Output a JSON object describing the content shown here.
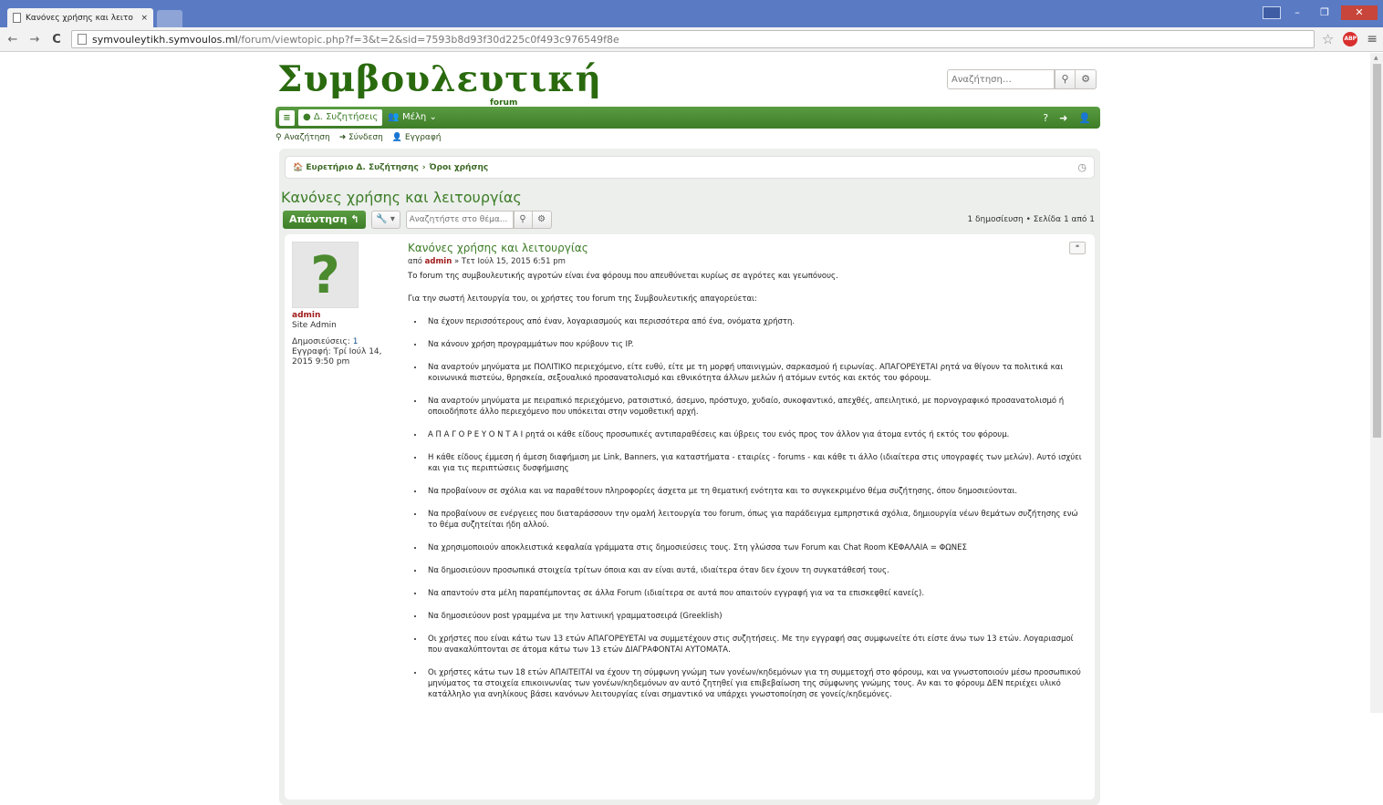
{
  "browser": {
    "tab_title": "Κανόνες χρήσης και λειτο",
    "tab_close": "×",
    "url_host": "symvouleytikh.symvoulos.ml",
    "url_path": "/forum/viewtopic.php?f=3&t=2&sid=7593b8d93f30d225c0f493c976549f8e",
    "back": "←",
    "forward": "→",
    "reload": "C",
    "star_icon": "☆",
    "abp_label": "ABP",
    "menu_icon": "≡",
    "win_min": "–",
    "win_max": "❐",
    "win_close": "✕"
  },
  "site": {
    "logo": "Συμβουλευτική",
    "logo_sub": "forum",
    "search_placeholder": "Αναζήτηση…",
    "search_icon": "⚲",
    "gear_icon": "⚙"
  },
  "navbar": {
    "menu_icon": "≡",
    "forum_label": "● Δ. Συζητήσεις",
    "members_label": "👥 Μέλη ⌄",
    "help_icon": "?",
    "login_icon": "➜",
    "register_icon": "👤"
  },
  "subnav": {
    "search": "⚲ Αναζήτηση",
    "login": "➜ Σύνδεση",
    "register": "👤 Εγγραφή"
  },
  "breadcrumbs": {
    "home": "🏠 Ευρετήριο Δ. Συζήτησης",
    "sep": "›",
    "current": "Όροι χρήσης",
    "clock_icon": "◷"
  },
  "topic": {
    "title": "Κανόνες χρήσης και λειτουργίας",
    "reply_label": "Απάντηση ↰",
    "tools_label": "🔧 ▾",
    "search_placeholder": "Αναζητήστε στο θέμα...",
    "pagination": "1 δημοσίευση • Σελίδα 1 από 1"
  },
  "post": {
    "avatar_char": "?",
    "author": "admin",
    "rank": "Site Admin",
    "posts_label": "Δημοσιεύσεις:",
    "posts_value": "1",
    "joined": "Εγγραφή: Τρί Ιούλ 14, 2015 9:50 pm",
    "quote_label": "❝",
    "title": "Κανόνες χρήσης και λειτουργίας",
    "meta_prefix": "από",
    "meta_author": "admin",
    "meta_date": "» Τετ Ιούλ 15, 2015 6:51 pm",
    "intro": "Το forum της συμβουλευτικής αγροτών είναι ένα φόρουμ που απευθύνεται κυρίως σε αγρότες και γεωπόνους.",
    "intro2": "Για την σωστή λειτουργία του, οι χρήστες του forum της Συμβουλευτικής απαγορεύεται:",
    "rules": [
      "Να έχουν περισσότερους από έναν, λογαριασμούς και περισσότερα από ένα, ονόματα χρήστη.",
      "Να κάνουν χρήση προγραμμάτων που κρύβουν τις IP.",
      "Να αναρτούν μηνύματα με ΠΟΛΙΤΙΚΟ περιεχόμενο, είτε ευθύ, είτε με τη μορφή υπαινιγμών, σαρκασμού ή ειρωνίας. ΑΠΑΓΟΡΕΥΕΤΑΙ ρητά να θίγουν τα πολιτικά και κοινωνικά πιστεύω, θρησκεία, σεξουαλικό προσανατολισμό και εθνικότητα άλλων μελών ή ατόμων εντός και εκτός του φόρουμ.",
      "Να αναρτούν μηνύματα με πειραπικό περιεχόμενο, ρατσιστικό, άσεμνο, πρόστυχο, χυδαίο, συκοφαντικό, απεχθές, απειλητικό, με πορνογραφικό προσανατολισμό ή οποιοδήποτε άλλο περιεχόμενο που υπόκειται στην νομοθετική αρχή.",
      "Α Π Α Γ Ο Ρ Ε Υ Ο Ν Τ Α Ι ρητά οι κάθε είδους προσωπικές αντιπαραθέσεις και ύβρεις του ενός προς τον άλλον για άτομα εντός ή εκτός του φόρουμ.",
      "Η κάθε είδους έμμεση ή άμεση διαφήμιση με Link, Banners, για καταστήματα - εταιρίες - forums - και κάθε τι άλλο (ιδιαίτερα στις υπογραφές των μελών). Αυτό ισχύει και για τις περιπτώσεις δυσφήμισης",
      "Να προβαίνουν σε σχόλια και να παραθέτουν πληροφορίες άσχετα με τη θεματική ενότητα και το συγκεκριμένο θέμα συζήτησης, όπου δημοσιεύονται.",
      "Να προβαίνουν σε ενέργειες που διαταράσσουν την ομαλή λειτουργία του forum, όπως για παράδειγμα εμπρηστικά σχόλια, δημιουργία νέων θεμάτων συζήτησης ενώ το θέμα συζητείται ήδη αλλού.",
      "Να χρησιμοποιούν αποκλειστικά κεφαλαία γράμματα στις δημοσιεύσεις τους. Στη γλώσσα των Forum και Chat Room ΚΕΦΑΛΑΙΑ = ΦΩΝΕΣ",
      "Να δημοσιεύουν προσωπικά στοιχεία τρίτων όποια και αν είναι αυτά, ιδιαίτερα όταν δεν έχουν τη συγκατάθεσή τους.",
      "Να απαντούν στα μέλη παραπέμποντας σε άλλα Forum (ιδιαίτερα σε αυτά που απαιτούν εγγραφή για να τα επισκεφθεί κανείς).",
      "Να δημοσιεύουν post γραμμένα με την λατινική γραμματοσειρά (Greeklish)",
      "Οι χρήστες που είναι κάτω των 13 ετών ΑΠΑΓΟΡΕΥΕΤΑΙ να συμμετέχουν στις συζητήσεις. Με την εγγραφή σας συμφωνείτε ότι είστε άνω των 13 ετών. Λογαριασμοί που ανακαλύπτονται σε άτομα κάτω των 13 ετών ΔΙΑΓΡΑΦΟΝΤΑΙ ΑΥΤΟΜΑΤΑ.",
      "Οι χρήστες κάτω των 18 ετών ΑΠΑΙΤΕΙΤΑΙ να έχουν τη σύμφωνη γνώμη των γονέων/κηδεμόνων για τη συμμετοχή στο φόρουμ, και να γνωστοποιούν μέσω προσωπικού μηνύματος τα στοιχεία επικοινωνίας των γονέων/κηδεμόνων αν αυτό ζητηθεί για επιβεβαίωση της σύμφωνης γνώμης τους. Αν και το φόρουμ ΔΕΝ περιέχει υλικό κατάλληλο για ανηλίκους βάσει κανόνων λειτουργίας είναι σημαντικό να υπάρχει γνωστοποίηση σε γονείς/κηδεμόνες."
    ]
  }
}
